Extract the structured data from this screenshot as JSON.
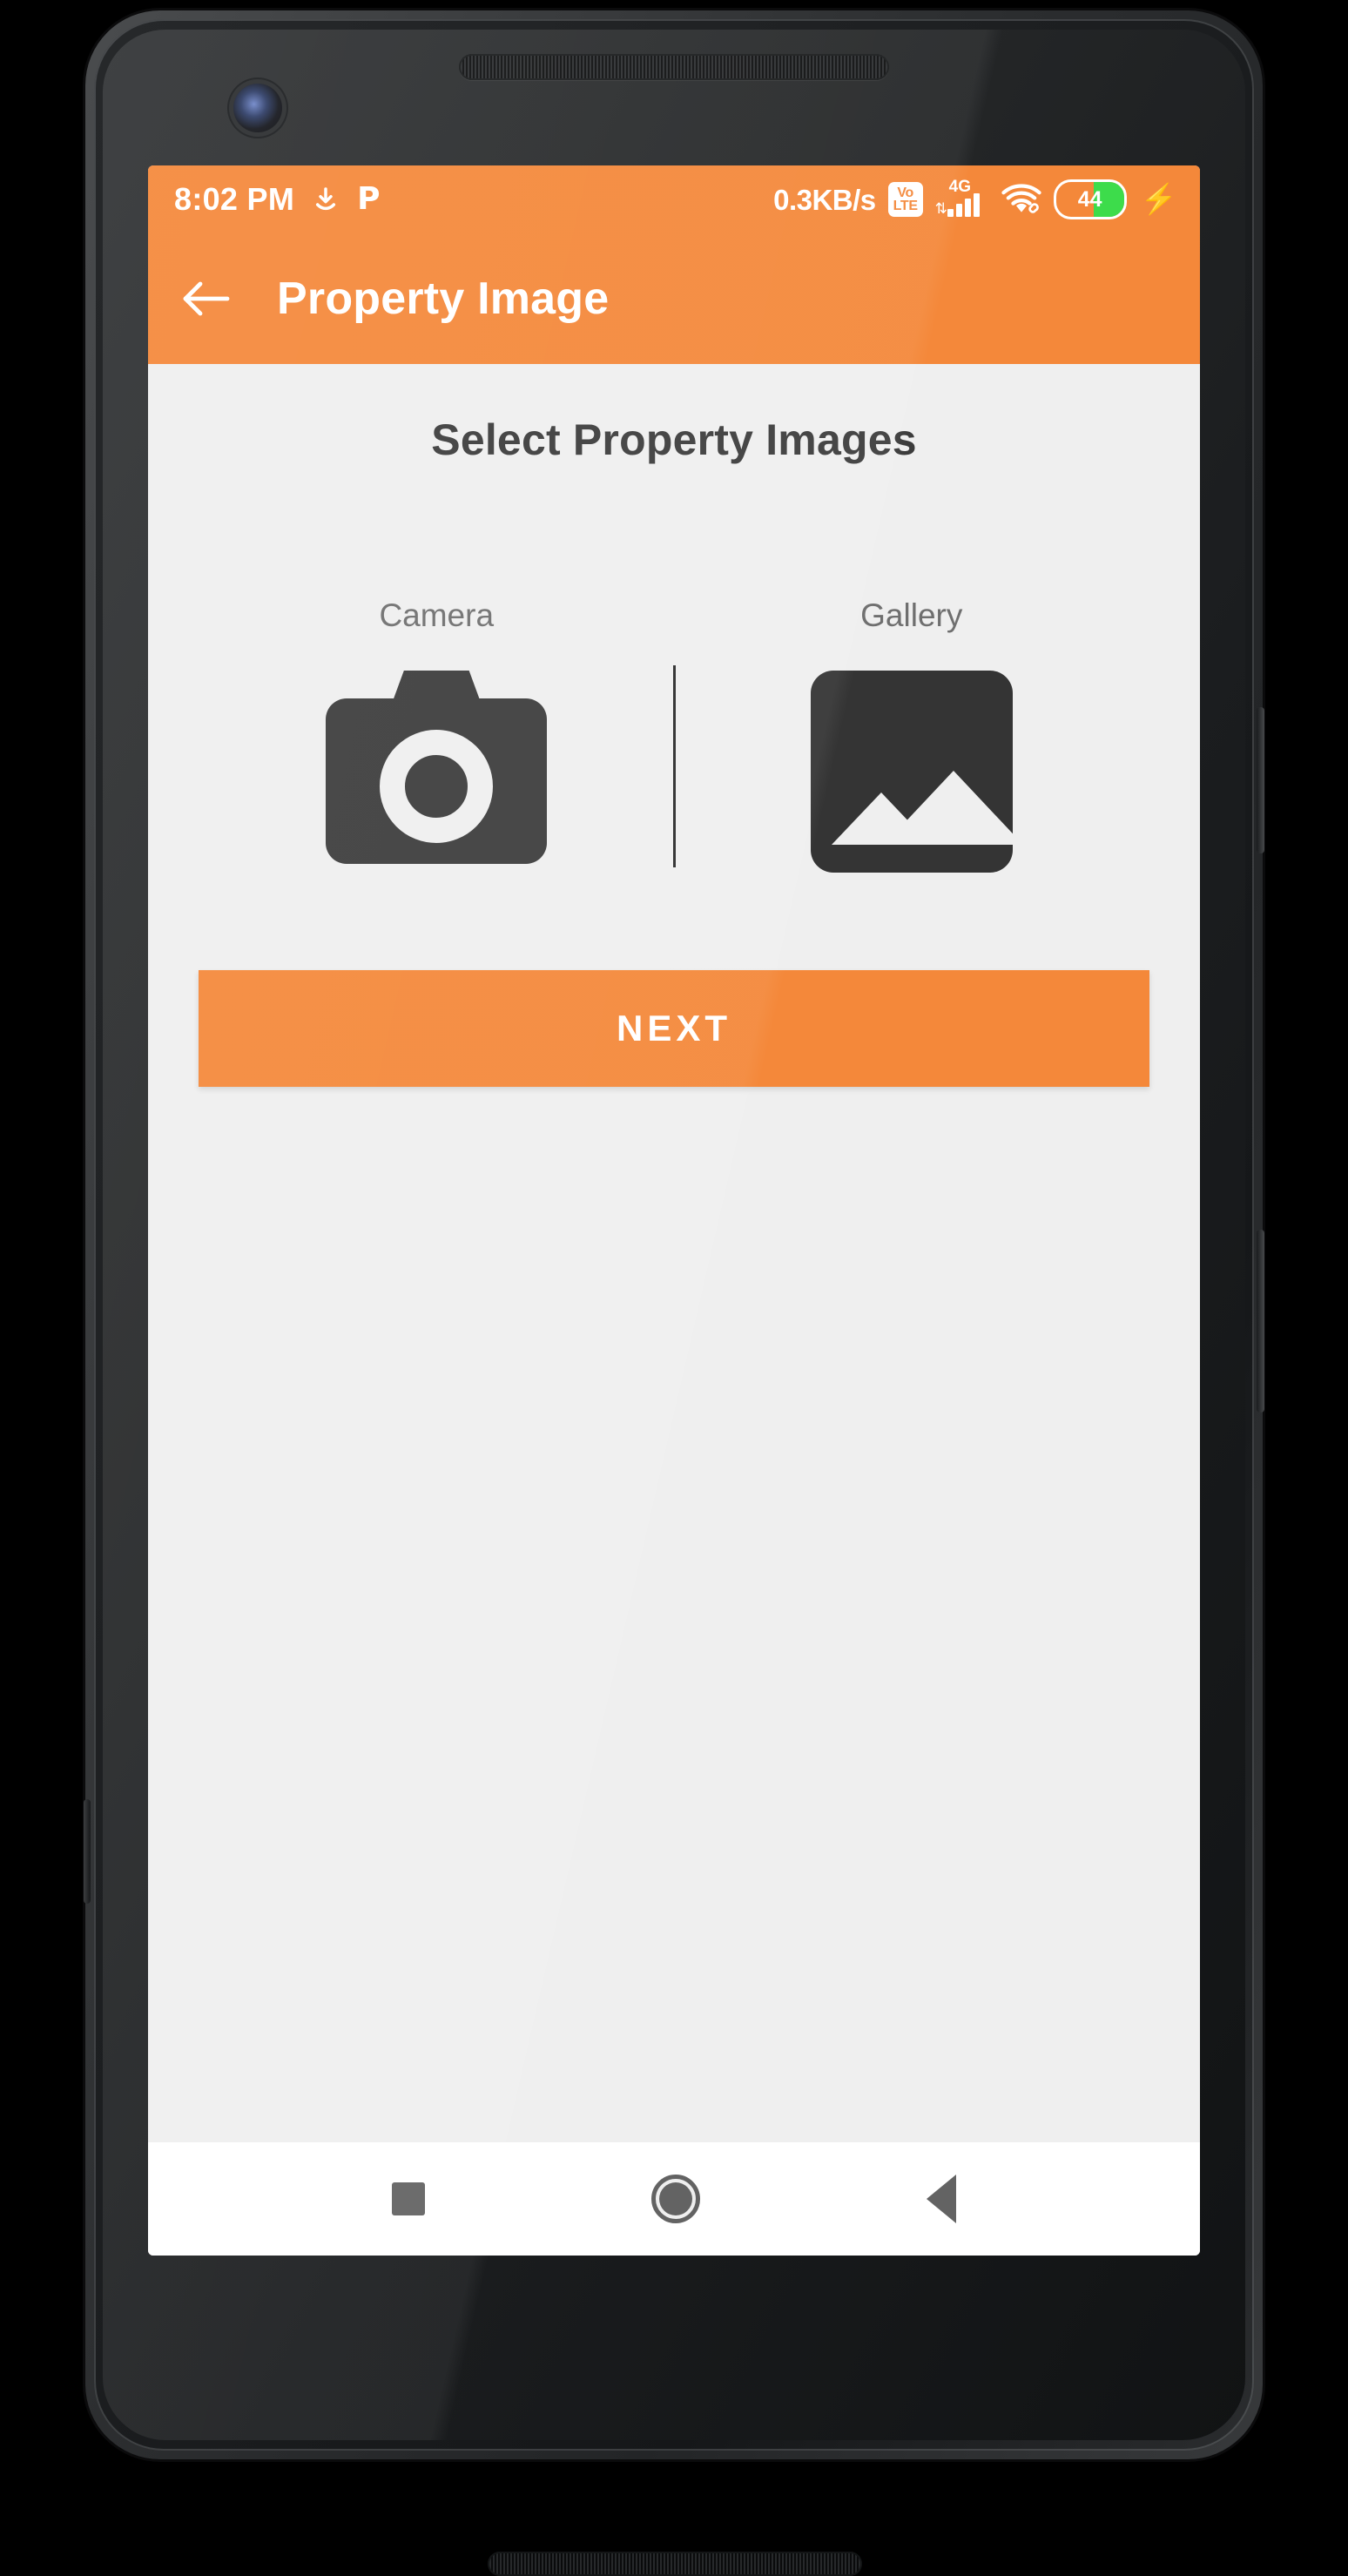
{
  "status_bar": {
    "time": "8:02 PM",
    "download_icon": "download-icon",
    "p_icon": "P",
    "net_speed": "0.3KB/s",
    "volte_top": "Vo",
    "volte_bottom": "LTE",
    "network_type": "4G",
    "data_arrows": "⇅",
    "wifi_icon": "wifi-icon",
    "battery_level": "44",
    "battery_fill_percent": 44,
    "charging_icon": "⚡"
  },
  "app_bar": {
    "back_icon": "back-arrow-icon",
    "title": "Property Image"
  },
  "main": {
    "heading": "Select Property Images",
    "sources": [
      {
        "label": "Camera",
        "icon": "camera-icon"
      },
      {
        "label": "Gallery",
        "icon": "gallery-image-icon"
      }
    ],
    "next_label": "NEXT"
  },
  "nav_bar": {
    "recents": "recents-square-icon",
    "home": "home-circle-icon",
    "back": "back-triangle-icon"
  },
  "colors": {
    "accent_orange": "#F4883A",
    "content_background": "#EFEFEF",
    "icon_dark": "#3C3C3C",
    "battery_green": "#3DDC4B",
    "nav_icon_gray": "#636363",
    "heading_text": "#3C3C3C",
    "label_text": "#6F6F6F"
  }
}
